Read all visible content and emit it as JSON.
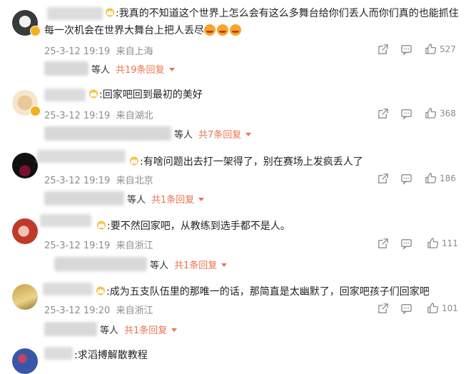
{
  "comments": [
    {
      "prefix": ":",
      "text_line1": "我真的不知道这个世界上怎么会有这么多舞台给你们丢人而你们真的也能抓住",
      "text_line2": "每一次机会在世界大舞台上把人丢尽",
      "time": "25-3-12 19:19",
      "location": "来自上海",
      "likes": "527",
      "reply_suffix": "等人",
      "reply_count": "共19条回复"
    },
    {
      "prefix": ":",
      "text_line1": "回家吧回到最初的美好",
      "time": "25-3-12 19:19",
      "location": "来自湖北",
      "likes": "368",
      "reply_suffix": "等人",
      "reply_count": "共7条回复"
    },
    {
      "prefix": ":",
      "text_line1": "有啥问题出去打一架得了，别在赛场上发疯丢人了",
      "time": "25-3-12 19:19",
      "location": "来自北京",
      "likes": "186",
      "reply_suffix": "等人",
      "reply_count": "共1条回复"
    },
    {
      "prefix": ":",
      "text_line1": "要不然回家吧，从教练到选手都不是人。",
      "time": "25-3-12 19:19",
      "location": "来自浙江",
      "likes": "111",
      "reply_suffix": "等人",
      "reply_count": "共1条回复"
    },
    {
      "prefix": ":",
      "text_line1": "成为五支队伍里的那唯一的话，那简直是太幽默了，回家吧孩子们回家吧",
      "time": "25-3-12 19:20",
      "location": "来自浙江",
      "likes": "101",
      "reply_suffix": "等人",
      "reply_count": "共1条回复"
    },
    {
      "prefix": ":",
      "text_line1": "求滔搏解散教程"
    }
  ],
  "colors": {
    "accent": "#eb7350",
    "meta": "#8c8c8c",
    "badge": "#f3b01d"
  },
  "icons": {
    "share": "share-icon",
    "comment": "comment-icon",
    "like": "thumbs-up-icon",
    "crown": "crown-icon",
    "emoji": "angry-face-emoji"
  }
}
